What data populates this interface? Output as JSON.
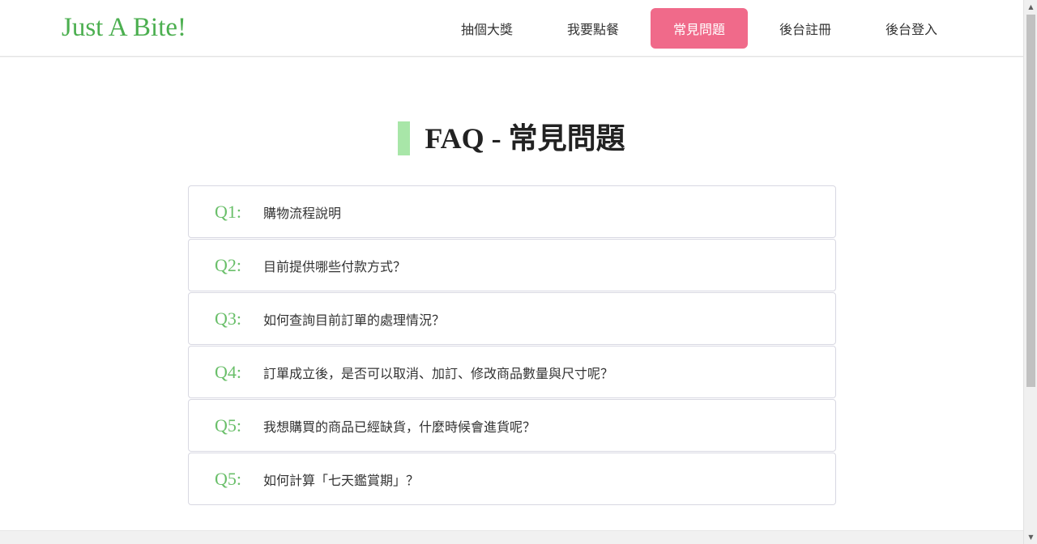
{
  "header": {
    "brand": "Just A Bite!",
    "nav": [
      {
        "label": "抽個大獎",
        "active": false
      },
      {
        "label": "我要點餐",
        "active": false
      },
      {
        "label": "常見問題",
        "active": true
      },
      {
        "label": "後台註冊",
        "active": false
      },
      {
        "label": "後台登入",
        "active": false
      }
    ]
  },
  "main": {
    "title": "FAQ - 常見問題",
    "faqs": [
      {
        "num": "Q1:",
        "question": "購物流程說明"
      },
      {
        "num": "Q2:",
        "question": "目前提供哪些付款方式？"
      },
      {
        "num": "Q3:",
        "question": "如何查詢目前訂單的處理情況？"
      },
      {
        "num": "Q4:",
        "question": "訂單成立後，是否可以取消、加訂、修改商品數量與尺寸呢？"
      },
      {
        "num": "Q5:",
        "question": "我想購買的商品已經缺貨，什麼時候會進貨呢？"
      },
      {
        "num": "Q5:",
        "question": "如何計算「七天鑑賞期」？"
      }
    ]
  },
  "colors": {
    "brand": "#4caf50",
    "active_nav": "#f06a8a",
    "faq_number": "#6abf6a",
    "title_bar": "#a8e6a8"
  },
  "icons": {
    "scroll_up": "scroll-up-arrow-icon",
    "scroll_down": "scroll-down-arrow-icon"
  }
}
